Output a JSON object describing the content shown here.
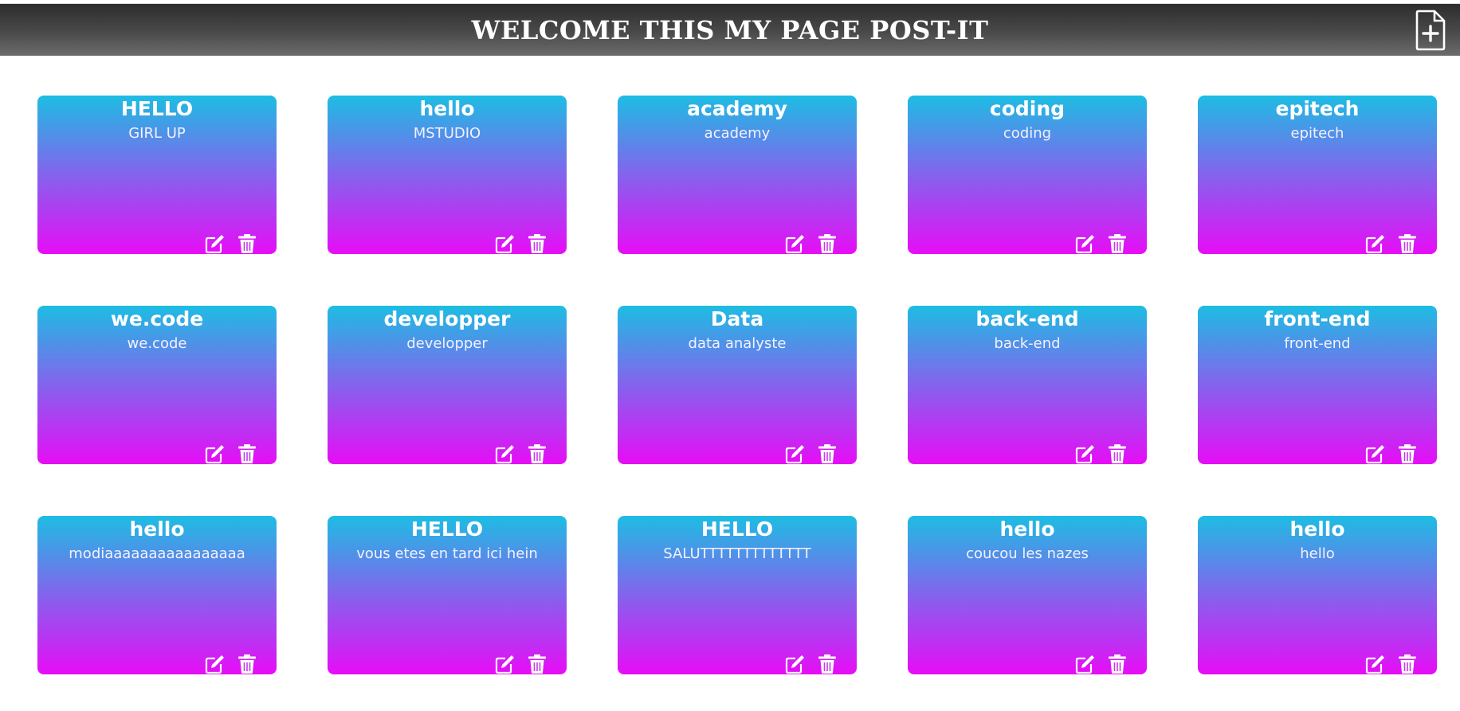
{
  "header": {
    "title": "WELCOME THIS MY PAGE POST-IT",
    "add_icon": "file-plus-icon"
  },
  "colors": {
    "header_dark": "#2c2c2c",
    "header_light": "#6c6c6c",
    "card_top": "#1dbde3",
    "card_bottom": "#e60df6",
    "text": "#ffffff"
  },
  "card_icons": {
    "edit": "edit-pencil-icon",
    "delete": "trash-icon"
  },
  "cards": [
    {
      "title": "HELLO",
      "body": "GIRL UP"
    },
    {
      "title": "hello",
      "body": "MSTUDIO"
    },
    {
      "title": "academy",
      "body": "academy"
    },
    {
      "title": "coding",
      "body": "coding"
    },
    {
      "title": "epitech",
      "body": "epitech"
    },
    {
      "title": "we.code",
      "body": "we.code"
    },
    {
      "title": "developper",
      "body": "developper"
    },
    {
      "title": "Data",
      "body": "data analyste"
    },
    {
      "title": "back-end",
      "body": "back-end"
    },
    {
      "title": "front-end",
      "body": "front-end"
    },
    {
      "title": "hello",
      "body": "modiaaaaaaaaaaaaaaaa"
    },
    {
      "title": "HELLO",
      "body": "vous etes en tard ici hein"
    },
    {
      "title": "HELLO",
      "body": "SALUTTTTTTTTTTTTT"
    },
    {
      "title": "hello",
      "body": "coucou les nazes"
    },
    {
      "title": "hello",
      "body": "hello"
    }
  ]
}
